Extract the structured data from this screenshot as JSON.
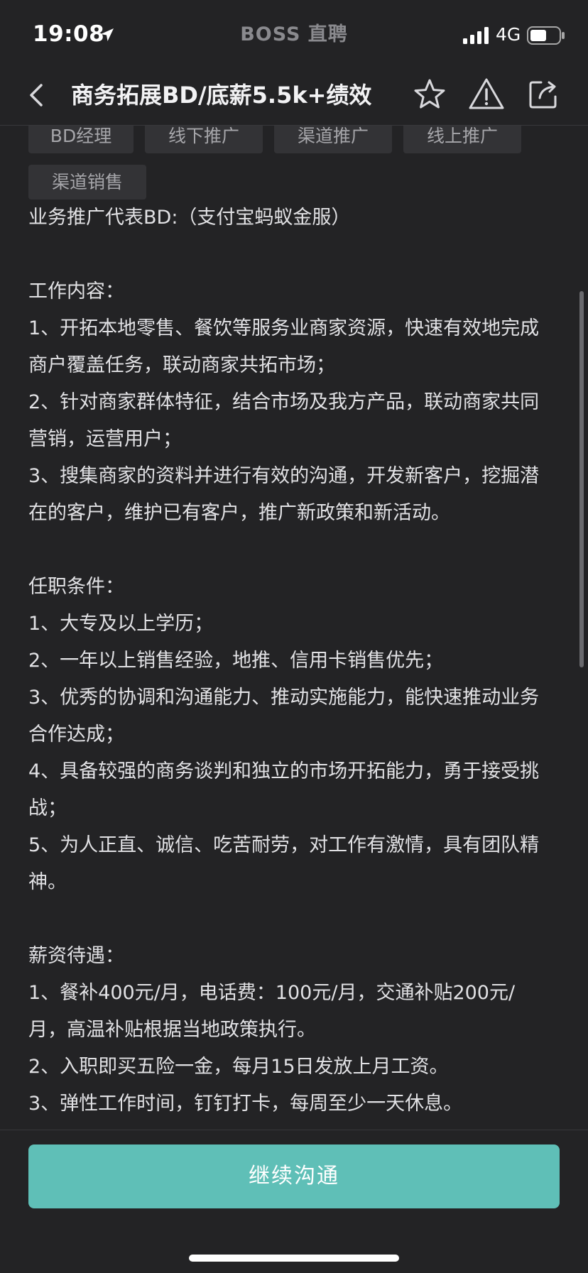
{
  "status_bar": {
    "time": "19:08",
    "app_name": "BOSS 直聘",
    "network": "4G"
  },
  "nav": {
    "title": "商务拓展BD/底薪5.5k+绩效",
    "icons": [
      "back-icon",
      "star-icon",
      "warning-icon",
      "share-icon"
    ]
  },
  "tags": [
    "BD经理",
    "线下推广",
    "渠道推广",
    "线上推广",
    "渠道销售"
  ],
  "description": {
    "lines": [
      "业务推广代表BD:（支付宝蚂蚁金服）",
      "",
      "工作内容：",
      "1、开拓本地零售、餐饮等服务业商家资源，快速有效地完成",
      "商户覆盖任务，联动商家共拓市场；",
      "2、针对商家群体特征，结合市场及我方产品，联动商家共同",
      "营销，运营用户；",
      "3、搜集商家的资料并进行有效的沟通，开发新客户，挖掘潜",
      "在的客户，维护已有客户，推广新政策和新活动。",
      "",
      "任职条件：",
      "1、大专及以上学历；",
      "2、一年以上销售经验，地推、信用卡销售优先；",
      "3、优秀的协调和沟通能力、推动实施能力，能快速推动业务",
      "合作达成；",
      "4、具备较强的商务谈判和独立的市场开拓能力，勇于接受挑",
      "战；",
      "5、为人正直、诚信、吃苦耐劳，对工作有激情，具有团队精",
      "神。",
      "",
      "薪资待遇：",
      "1、餐补400元/月，电话费：100元/月，交通补贴200元/",
      "月，高温补贴根据当地政策执行。",
      "2、入职即买五险一金，每月15日发放上月工资。",
      "3、弹性工作时间，钉钉打卡，每周至少一天休息。"
    ]
  },
  "cta": {
    "label": "继续沟通"
  },
  "colors": {
    "background": "#232325",
    "accent": "#5fbfb7",
    "tag_bg": "#333336"
  }
}
